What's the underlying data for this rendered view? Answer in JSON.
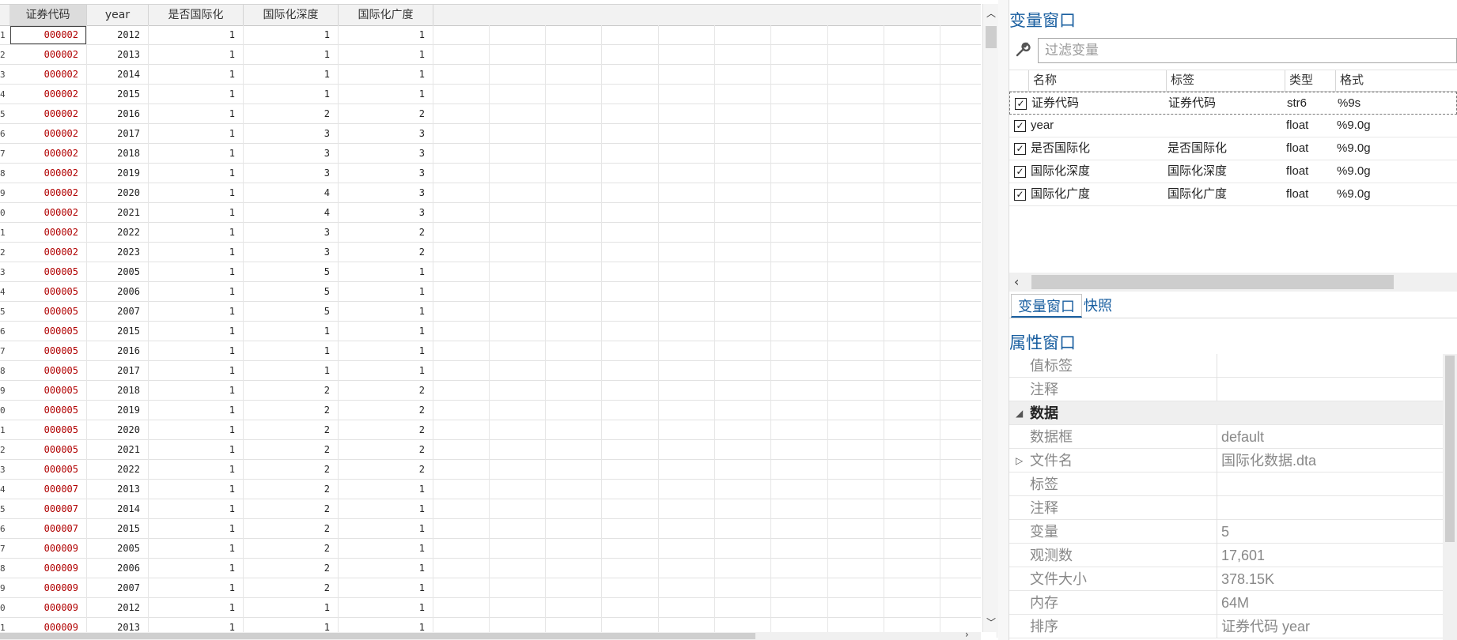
{
  "grid": {
    "columns": [
      "证券代码",
      "year",
      "是否国际化",
      "国际化深度",
      "国际化广度"
    ],
    "rows": [
      {
        "n": "1",
        "code": "000002",
        "year": "2012",
        "intl": "1",
        "depth": "1",
        "breadth": "1"
      },
      {
        "n": "2",
        "code": "000002",
        "year": "2013",
        "intl": "1",
        "depth": "1",
        "breadth": "1"
      },
      {
        "n": "3",
        "code": "000002",
        "year": "2014",
        "intl": "1",
        "depth": "1",
        "breadth": "1"
      },
      {
        "n": "4",
        "code": "000002",
        "year": "2015",
        "intl": "1",
        "depth": "1",
        "breadth": "1"
      },
      {
        "n": "5",
        "code": "000002",
        "year": "2016",
        "intl": "1",
        "depth": "2",
        "breadth": "2"
      },
      {
        "n": "6",
        "code": "000002",
        "year": "2017",
        "intl": "1",
        "depth": "3",
        "breadth": "3"
      },
      {
        "n": "7",
        "code": "000002",
        "year": "2018",
        "intl": "1",
        "depth": "3",
        "breadth": "3"
      },
      {
        "n": "8",
        "code": "000002",
        "year": "2019",
        "intl": "1",
        "depth": "3",
        "breadth": "3"
      },
      {
        "n": "9",
        "code": "000002",
        "year": "2020",
        "intl": "1",
        "depth": "4",
        "breadth": "3"
      },
      {
        "n": "0",
        "code": "000002",
        "year": "2021",
        "intl": "1",
        "depth": "4",
        "breadth": "3"
      },
      {
        "n": "1",
        "code": "000002",
        "year": "2022",
        "intl": "1",
        "depth": "3",
        "breadth": "2"
      },
      {
        "n": "2",
        "code": "000002",
        "year": "2023",
        "intl": "1",
        "depth": "3",
        "breadth": "2"
      },
      {
        "n": "3",
        "code": "000005",
        "year": "2005",
        "intl": "1",
        "depth": "5",
        "breadth": "1"
      },
      {
        "n": "4",
        "code": "000005",
        "year": "2006",
        "intl": "1",
        "depth": "5",
        "breadth": "1"
      },
      {
        "n": "5",
        "code": "000005",
        "year": "2007",
        "intl": "1",
        "depth": "5",
        "breadth": "1"
      },
      {
        "n": "6",
        "code": "000005",
        "year": "2015",
        "intl": "1",
        "depth": "1",
        "breadth": "1"
      },
      {
        "n": "7",
        "code": "000005",
        "year": "2016",
        "intl": "1",
        "depth": "1",
        "breadth": "1"
      },
      {
        "n": "8",
        "code": "000005",
        "year": "2017",
        "intl": "1",
        "depth": "1",
        "breadth": "1"
      },
      {
        "n": "9",
        "code": "000005",
        "year": "2018",
        "intl": "1",
        "depth": "2",
        "breadth": "2"
      },
      {
        "n": "0",
        "code": "000005",
        "year": "2019",
        "intl": "1",
        "depth": "2",
        "breadth": "2"
      },
      {
        "n": "1",
        "code": "000005",
        "year": "2020",
        "intl": "1",
        "depth": "2",
        "breadth": "2"
      },
      {
        "n": "2",
        "code": "000005",
        "year": "2021",
        "intl": "1",
        "depth": "2",
        "breadth": "2"
      },
      {
        "n": "3",
        "code": "000005",
        "year": "2022",
        "intl": "1",
        "depth": "2",
        "breadth": "2"
      },
      {
        "n": "4",
        "code": "000007",
        "year": "2013",
        "intl": "1",
        "depth": "2",
        "breadth": "1"
      },
      {
        "n": "5",
        "code": "000007",
        "year": "2014",
        "intl": "1",
        "depth": "2",
        "breadth": "1"
      },
      {
        "n": "6",
        "code": "000007",
        "year": "2015",
        "intl": "1",
        "depth": "2",
        "breadth": "1"
      },
      {
        "n": "7",
        "code": "000009",
        "year": "2005",
        "intl": "1",
        "depth": "2",
        "breadth": "1"
      },
      {
        "n": "8",
        "code": "000009",
        "year": "2006",
        "intl": "1",
        "depth": "2",
        "breadth": "1"
      },
      {
        "n": "9",
        "code": "000009",
        "year": "2007",
        "intl": "1",
        "depth": "2",
        "breadth": "1"
      },
      {
        "n": "0",
        "code": "000009",
        "year": "2012",
        "intl": "1",
        "depth": "1",
        "breadth": "1"
      },
      {
        "n": "1",
        "code": "000009",
        "year": "2013",
        "intl": "1",
        "depth": "1",
        "breadth": "1"
      }
    ],
    "code_color": "#b00000"
  },
  "var_window": {
    "title": "变量窗口",
    "filter_placeholder": "过滤变量",
    "headers": [
      "名称",
      "标签",
      "类型",
      "格式"
    ],
    "vars": [
      {
        "name": "证券代码",
        "label": "证券代码",
        "type": "str6",
        "format": "%9s",
        "checked": true
      },
      {
        "name": "year",
        "label": "",
        "type": "float",
        "format": "%9.0g",
        "checked": true
      },
      {
        "name": "是否国际化",
        "label": "是否国际化",
        "type": "float",
        "format": "%9.0g",
        "checked": true
      },
      {
        "name": "国际化深度",
        "label": "国际化深度",
        "type": "float",
        "format": "%9.0g",
        "checked": true
      },
      {
        "name": "国际化广度",
        "label": "国际化广度",
        "type": "float",
        "format": "%9.0g",
        "checked": true
      }
    ]
  },
  "tabs": [
    "变量窗口",
    "快照"
  ],
  "prop_window": {
    "title": "属性窗口",
    "rows": [
      {
        "key": "值标签",
        "value": ""
      },
      {
        "key": "注释",
        "value": ""
      },
      {
        "key": "数据",
        "value": "",
        "section": true
      },
      {
        "key": "数据框",
        "value": "default"
      },
      {
        "key": "文件名",
        "value": "国际化数据.dta",
        "expand": true
      },
      {
        "key": "标签",
        "value": ""
      },
      {
        "key": "注释",
        "value": ""
      },
      {
        "key": "变量",
        "value": "5"
      },
      {
        "key": "观测数",
        "value": "17,601"
      },
      {
        "key": "文件大小",
        "value": "378.15K"
      },
      {
        "key": "内存",
        "value": "64M"
      },
      {
        "key": "排序",
        "value": "证券代码 year"
      }
    ]
  },
  "accent_color": "#1a5fa0"
}
